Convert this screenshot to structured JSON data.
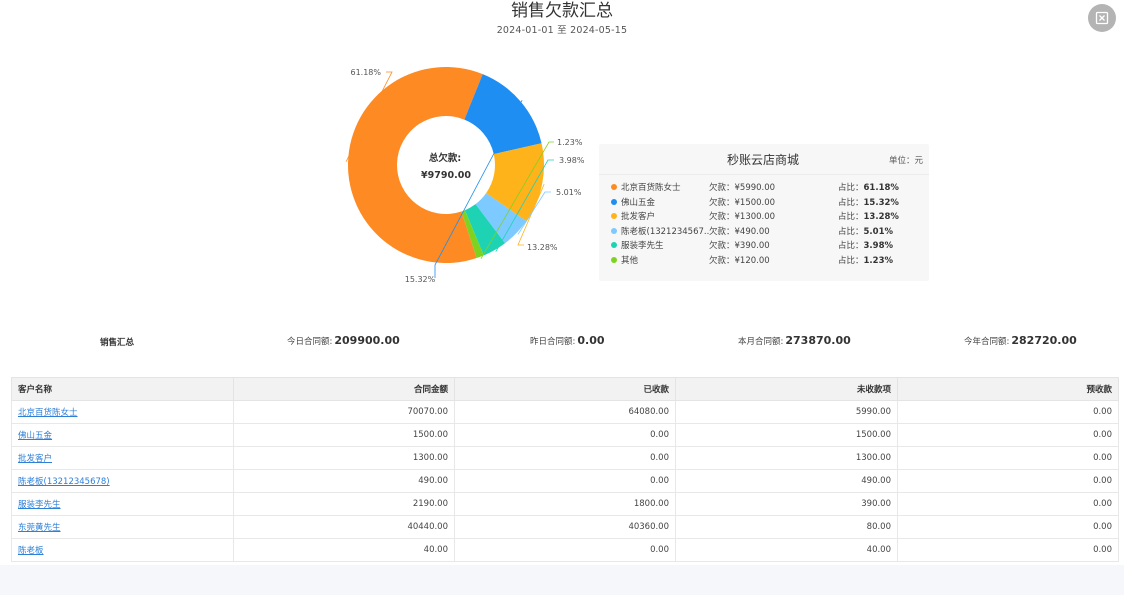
{
  "header": {
    "title": "销售欠款汇总",
    "date_start": "2024-01-01",
    "date_sep": "至",
    "date_end": "2024-05-15"
  },
  "close_icon": "close-icon",
  "chart_data": {
    "type": "pie",
    "center_label": "总欠款:",
    "center_value": "¥9790.00",
    "slices": [
      {
        "name": "北京百货陈女士",
        "debt": 5990.0,
        "pct": "61.18%",
        "color": "#fe8a23"
      },
      {
        "name": "佛山五金",
        "debt": 1500.0,
        "pct": "15.32%",
        "color": "#1e8ef2"
      },
      {
        "name": "批发客户",
        "debt": 1300.0,
        "pct": "13.28%",
        "color": "#ffb31a"
      },
      {
        "name": "陈老板(13212345678)",
        "debt": 490.0,
        "pct": "5.01%",
        "color": "#7ccaff"
      },
      {
        "name": "服装李先生",
        "debt": 390.0,
        "pct": "3.98%",
        "color": "#1ed3b4"
      },
      {
        "name": "其他",
        "debt": 120.0,
        "pct": "1.23%",
        "color": "#7ed321"
      }
    ]
  },
  "legend": {
    "store": "秒账云店商城",
    "unit": "单位：元",
    "rows": [
      {
        "name": "北京百货陈女士",
        "debt": "欠款：¥5990.00",
        "ratio_label": "占比：",
        "ratio": "61.18%"
      },
      {
        "name": "佛山五金",
        "debt": "欠款：¥1500.00",
        "ratio_label": "占比：",
        "ratio": "15.32%"
      },
      {
        "name": "批发客户",
        "debt": "欠款：¥1300.00",
        "ratio_label": "占比：",
        "ratio": "13.28%"
      },
      {
        "name": "陈老板(1321234567...",
        "debt": "欠款：¥490.00",
        "ratio_label": "占比：",
        "ratio": "5.01%"
      },
      {
        "name": "服装李先生",
        "debt": "欠款：¥390.00",
        "ratio_label": "占比：",
        "ratio": "3.98%"
      },
      {
        "name": "其他",
        "debt": "欠款：¥120.00",
        "ratio_label": "占比：",
        "ratio": "1.23%"
      }
    ]
  },
  "summary": {
    "title": "销售汇总",
    "today_label": "今日合同额:",
    "today_value": "209900.00",
    "yesterday_label": "昨日合同额:",
    "yesterday_value": "0.00",
    "month_label": "本月合同额:",
    "month_value": "273870.00",
    "year_label": "今年合同额:",
    "year_value": "282720.00"
  },
  "table": {
    "headers": [
      "客户名称",
      "合同金额",
      "已收款",
      "未收款项",
      "预收款"
    ],
    "rows": [
      [
        "北京百货陈女士",
        "70070.00",
        "64080.00",
        "5990.00",
        "0.00"
      ],
      [
        "佛山五金",
        "1500.00",
        "0.00",
        "1500.00",
        "0.00"
      ],
      [
        "批发客户",
        "1300.00",
        "0.00",
        "1300.00",
        "0.00"
      ],
      [
        "陈老板(13212345678)",
        "490.00",
        "0.00",
        "490.00",
        "0.00"
      ],
      [
        "服装李先生",
        "2190.00",
        "1800.00",
        "390.00",
        "0.00"
      ],
      [
        "东莞黄先生",
        "40440.00",
        "40360.00",
        "80.00",
        "0.00"
      ],
      [
        "陈老板",
        "40.00",
        "0.00",
        "40.00",
        "0.00"
      ]
    ]
  }
}
